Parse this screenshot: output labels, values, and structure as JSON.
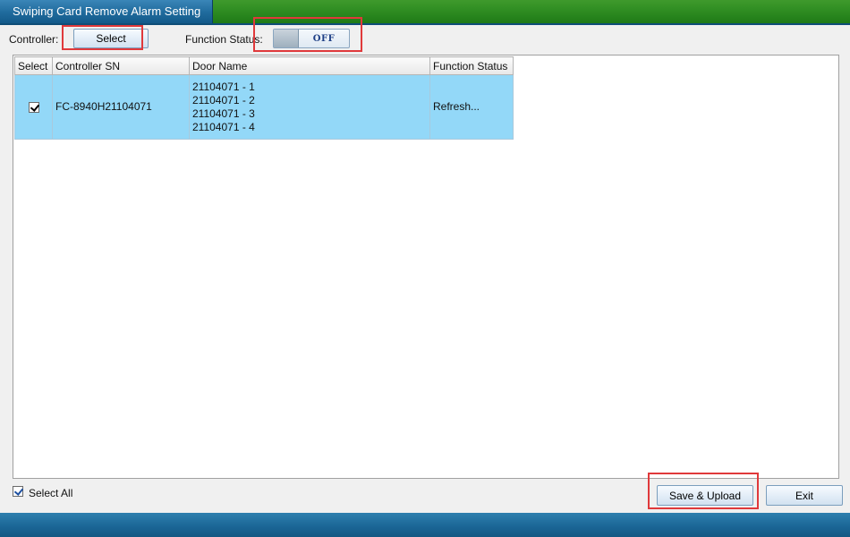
{
  "window": {
    "title": "Swiping Card Remove Alarm Setting"
  },
  "toolbar": {
    "controller_label": "Controller:",
    "select_button": "Select",
    "function_status_label": "Function Status:",
    "toggle_state": "OFF"
  },
  "grid": {
    "columns": [
      "Select",
      "Controller SN",
      "Door Name",
      "Function Status"
    ],
    "rows": [
      {
        "selected": true,
        "controller_sn": "FC-8940H21104071",
        "door_names": [
          "21104071 - 1",
          "21104071 - 2",
          "21104071 - 3",
          "21104071 - 4"
        ],
        "function_status": "Refresh..."
      }
    ]
  },
  "footer": {
    "select_all_label": "Select All",
    "select_all_checked": true,
    "save_button": "Save & Upload",
    "exit_button": "Exit"
  },
  "colors": {
    "selected_row": "#93d8f8",
    "highlight": "#e0393b",
    "title_tab": "#1f6a9c",
    "title_bar": "#2f8d22"
  }
}
